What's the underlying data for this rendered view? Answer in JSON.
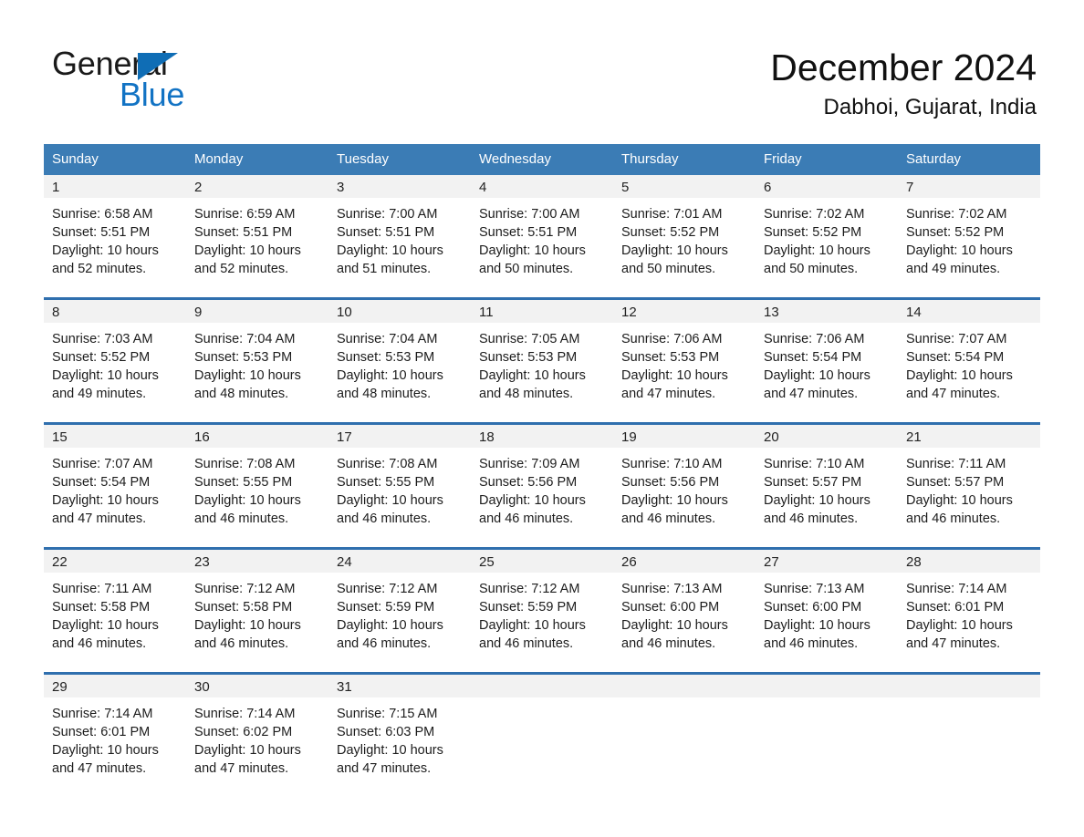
{
  "brand": {
    "word_one": "General",
    "word_two": "Blue",
    "triangle_color": "#0f6db5",
    "blue_color": "#1273c4",
    "triangle_icon": "brand-triangle-icon"
  },
  "header": {
    "month_title": "December 2024",
    "location": "Dabhoi, Gujarat, India"
  },
  "theme": {
    "header_blue": "#3b7cb5",
    "row_divider_blue": "#2f6fae",
    "day_number_band": "#f2f2f2",
    "text_color": "#1c1c1c"
  },
  "weekdays": [
    "Sunday",
    "Monday",
    "Tuesday",
    "Wednesday",
    "Thursday",
    "Friday",
    "Saturday"
  ],
  "weeks": [
    [
      {
        "day": "1",
        "sunrise": "Sunrise: 6:58 AM",
        "sunset": "Sunset: 5:51 PM",
        "daylight_1": "Daylight: 10 hours",
        "daylight_2": "and 52 minutes."
      },
      {
        "day": "2",
        "sunrise": "Sunrise: 6:59 AM",
        "sunset": "Sunset: 5:51 PM",
        "daylight_1": "Daylight: 10 hours",
        "daylight_2": "and 52 minutes."
      },
      {
        "day": "3",
        "sunrise": "Sunrise: 7:00 AM",
        "sunset": "Sunset: 5:51 PM",
        "daylight_1": "Daylight: 10 hours",
        "daylight_2": "and 51 minutes."
      },
      {
        "day": "4",
        "sunrise": "Sunrise: 7:00 AM",
        "sunset": "Sunset: 5:51 PM",
        "daylight_1": "Daylight: 10 hours",
        "daylight_2": "and 50 minutes."
      },
      {
        "day": "5",
        "sunrise": "Sunrise: 7:01 AM",
        "sunset": "Sunset: 5:52 PM",
        "daylight_1": "Daylight: 10 hours",
        "daylight_2": "and 50 minutes."
      },
      {
        "day": "6",
        "sunrise": "Sunrise: 7:02 AM",
        "sunset": "Sunset: 5:52 PM",
        "daylight_1": "Daylight: 10 hours",
        "daylight_2": "and 50 minutes."
      },
      {
        "day": "7",
        "sunrise": "Sunrise: 7:02 AM",
        "sunset": "Sunset: 5:52 PM",
        "daylight_1": "Daylight: 10 hours",
        "daylight_2": "and 49 minutes."
      }
    ],
    [
      {
        "day": "8",
        "sunrise": "Sunrise: 7:03 AM",
        "sunset": "Sunset: 5:52 PM",
        "daylight_1": "Daylight: 10 hours",
        "daylight_2": "and 49 minutes."
      },
      {
        "day": "9",
        "sunrise": "Sunrise: 7:04 AM",
        "sunset": "Sunset: 5:53 PM",
        "daylight_1": "Daylight: 10 hours",
        "daylight_2": "and 48 minutes."
      },
      {
        "day": "10",
        "sunrise": "Sunrise: 7:04 AM",
        "sunset": "Sunset: 5:53 PM",
        "daylight_1": "Daylight: 10 hours",
        "daylight_2": "and 48 minutes."
      },
      {
        "day": "11",
        "sunrise": "Sunrise: 7:05 AM",
        "sunset": "Sunset: 5:53 PM",
        "daylight_1": "Daylight: 10 hours",
        "daylight_2": "and 48 minutes."
      },
      {
        "day": "12",
        "sunrise": "Sunrise: 7:06 AM",
        "sunset": "Sunset: 5:53 PM",
        "daylight_1": "Daylight: 10 hours",
        "daylight_2": "and 47 minutes."
      },
      {
        "day": "13",
        "sunrise": "Sunrise: 7:06 AM",
        "sunset": "Sunset: 5:54 PM",
        "daylight_1": "Daylight: 10 hours",
        "daylight_2": "and 47 minutes."
      },
      {
        "day": "14",
        "sunrise": "Sunrise: 7:07 AM",
        "sunset": "Sunset: 5:54 PM",
        "daylight_1": "Daylight: 10 hours",
        "daylight_2": "and 47 minutes."
      }
    ],
    [
      {
        "day": "15",
        "sunrise": "Sunrise: 7:07 AM",
        "sunset": "Sunset: 5:54 PM",
        "daylight_1": "Daylight: 10 hours",
        "daylight_2": "and 47 minutes."
      },
      {
        "day": "16",
        "sunrise": "Sunrise: 7:08 AM",
        "sunset": "Sunset: 5:55 PM",
        "daylight_1": "Daylight: 10 hours",
        "daylight_2": "and 46 minutes."
      },
      {
        "day": "17",
        "sunrise": "Sunrise: 7:08 AM",
        "sunset": "Sunset: 5:55 PM",
        "daylight_1": "Daylight: 10 hours",
        "daylight_2": "and 46 minutes."
      },
      {
        "day": "18",
        "sunrise": "Sunrise: 7:09 AM",
        "sunset": "Sunset: 5:56 PM",
        "daylight_1": "Daylight: 10 hours",
        "daylight_2": "and 46 minutes."
      },
      {
        "day": "19",
        "sunrise": "Sunrise: 7:10 AM",
        "sunset": "Sunset: 5:56 PM",
        "daylight_1": "Daylight: 10 hours",
        "daylight_2": "and 46 minutes."
      },
      {
        "day": "20",
        "sunrise": "Sunrise: 7:10 AM",
        "sunset": "Sunset: 5:57 PM",
        "daylight_1": "Daylight: 10 hours",
        "daylight_2": "and 46 minutes."
      },
      {
        "day": "21",
        "sunrise": "Sunrise: 7:11 AM",
        "sunset": "Sunset: 5:57 PM",
        "daylight_1": "Daylight: 10 hours",
        "daylight_2": "and 46 minutes."
      }
    ],
    [
      {
        "day": "22",
        "sunrise": "Sunrise: 7:11 AM",
        "sunset": "Sunset: 5:58 PM",
        "daylight_1": "Daylight: 10 hours",
        "daylight_2": "and 46 minutes."
      },
      {
        "day": "23",
        "sunrise": "Sunrise: 7:12 AM",
        "sunset": "Sunset: 5:58 PM",
        "daylight_1": "Daylight: 10 hours",
        "daylight_2": "and 46 minutes."
      },
      {
        "day": "24",
        "sunrise": "Sunrise: 7:12 AM",
        "sunset": "Sunset: 5:59 PM",
        "daylight_1": "Daylight: 10 hours",
        "daylight_2": "and 46 minutes."
      },
      {
        "day": "25",
        "sunrise": "Sunrise: 7:12 AM",
        "sunset": "Sunset: 5:59 PM",
        "daylight_1": "Daylight: 10 hours",
        "daylight_2": "and 46 minutes."
      },
      {
        "day": "26",
        "sunrise": "Sunrise: 7:13 AM",
        "sunset": "Sunset: 6:00 PM",
        "daylight_1": "Daylight: 10 hours",
        "daylight_2": "and 46 minutes."
      },
      {
        "day": "27",
        "sunrise": "Sunrise: 7:13 AM",
        "sunset": "Sunset: 6:00 PM",
        "daylight_1": "Daylight: 10 hours",
        "daylight_2": "and 46 minutes."
      },
      {
        "day": "28",
        "sunrise": "Sunrise: 7:14 AM",
        "sunset": "Sunset: 6:01 PM",
        "daylight_1": "Daylight: 10 hours",
        "daylight_2": "and 47 minutes."
      }
    ],
    [
      {
        "day": "29",
        "sunrise": "Sunrise: 7:14 AM",
        "sunset": "Sunset: 6:01 PM",
        "daylight_1": "Daylight: 10 hours",
        "daylight_2": "and 47 minutes."
      },
      {
        "day": "30",
        "sunrise": "Sunrise: 7:14 AM",
        "sunset": "Sunset: 6:02 PM",
        "daylight_1": "Daylight: 10 hours",
        "daylight_2": "and 47 minutes."
      },
      {
        "day": "31",
        "sunrise": "Sunrise: 7:15 AM",
        "sunset": "Sunset: 6:03 PM",
        "daylight_1": "Daylight: 10 hours",
        "daylight_2": "and 47 minutes."
      },
      {
        "day": "",
        "sunrise": "",
        "sunset": "",
        "daylight_1": "",
        "daylight_2": "",
        "empty": true
      },
      {
        "day": "",
        "sunrise": "",
        "sunset": "",
        "daylight_1": "",
        "daylight_2": "",
        "empty": true
      },
      {
        "day": "",
        "sunrise": "",
        "sunset": "",
        "daylight_1": "",
        "daylight_2": "",
        "empty": true
      },
      {
        "day": "",
        "sunrise": "",
        "sunset": "",
        "daylight_1": "",
        "daylight_2": "",
        "empty": true
      }
    ]
  ]
}
